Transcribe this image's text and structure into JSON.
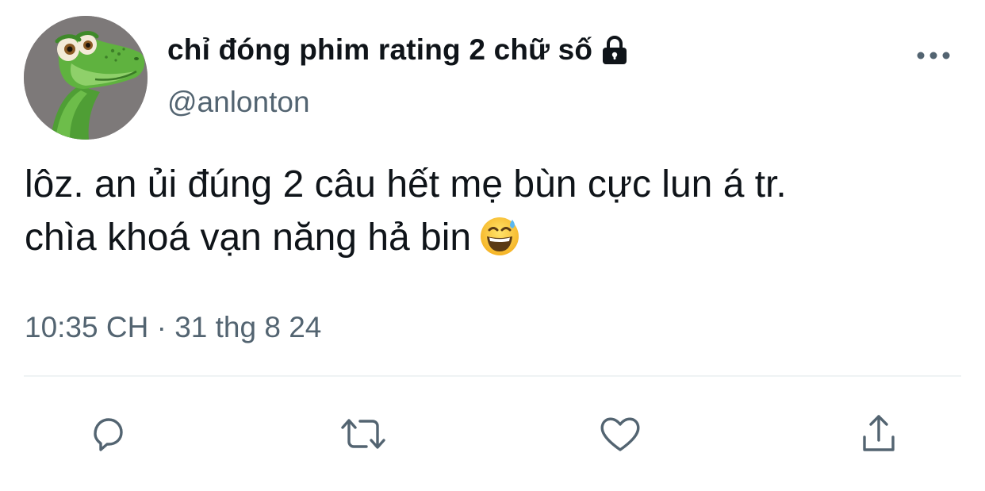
{
  "user": {
    "display_name": "chỉ đóng phim rating 2 chữ số",
    "handle": "@anlonton",
    "protected_icon": "lock-icon",
    "avatar": "dinosaur-avatar"
  },
  "tweet": {
    "lines": [
      "lôz. an ủi đúng 2 câu hết mẹ bùn cực lun á tr.",
      "chìa khoá vạn năng hả bin"
    ],
    "emoji": "grinning-face-with-sweat",
    "timestamp": "10:35 CH · 31 thg 8 24"
  },
  "actions": [
    "reply-icon",
    "retweet-icon",
    "like-icon",
    "share-icon"
  ],
  "colors": {
    "text": "#0f1419",
    "secondary": "#536471",
    "divider": "#eff3f4"
  }
}
